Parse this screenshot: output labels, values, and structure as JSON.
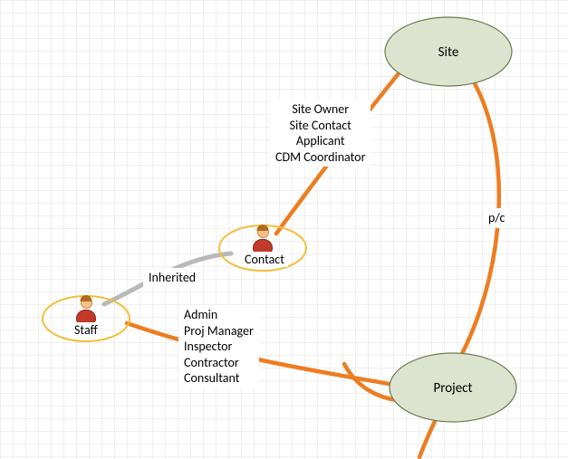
{
  "nodes": {
    "site": {
      "label": "Site"
    },
    "project": {
      "label": "Project"
    },
    "contact": {
      "label": "Contact"
    },
    "staff": {
      "label": "Staff"
    }
  },
  "edges": {
    "site_contact": {
      "roles": [
        "Site Owner",
        "Site Contact",
        "Applicant",
        "CDM Coordinator"
      ]
    },
    "site_project": {
      "label": "p/c"
    },
    "contact_staff": {
      "label": "Inherited"
    },
    "staff_project": {
      "roles": [
        "Admin",
        "Proj Manager",
        "Inspector",
        "Contractor",
        "Consultant"
      ]
    }
  }
}
